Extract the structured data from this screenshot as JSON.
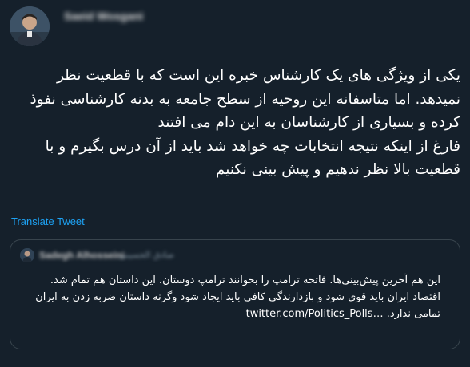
{
  "author": {
    "name": "Saeid Wosgani"
  },
  "tweet": {
    "paragraphs": [
      "یکی از ویژگی های یک کارشناس خبره این است که با قطعیت نظر نمیدهد. اما متاسفانه این روحیه از سطح جامعه به بدنه کارشناسی نفوذ کرده و بسیاری از کارشناسان به این دام می افتند",
      "فارغ از اینکه نتیجه انتخابات چه خواهد شد باید از آن درس بگیرم و با قطعیت بالا نظر ندهیم و پیش بینی نکنیم"
    ]
  },
  "translate_label": "Translate Tweet",
  "quoted": {
    "name": "Sadegh Alhosseini",
    "handle": "صادق الحسینی",
    "paragraphs": [
      "این هم آخرین پیش‌بینی‌ها. فاتحه ترامپ را بخوانند ترامپ دوستان. این داستان هم تمام شد.",
      "اقتصاد ایران باید قوی شود و بازدارندگی کافی باید ایجاد شود وگرنه داستان ضربه زدن به ایران تمامی ندارد."
    ],
    "link": "twitter.com/Politics_Polls…"
  },
  "colors": {
    "background": "#15202b",
    "text": "#ffffff",
    "link": "#1da1f2",
    "border": "#38444d"
  }
}
